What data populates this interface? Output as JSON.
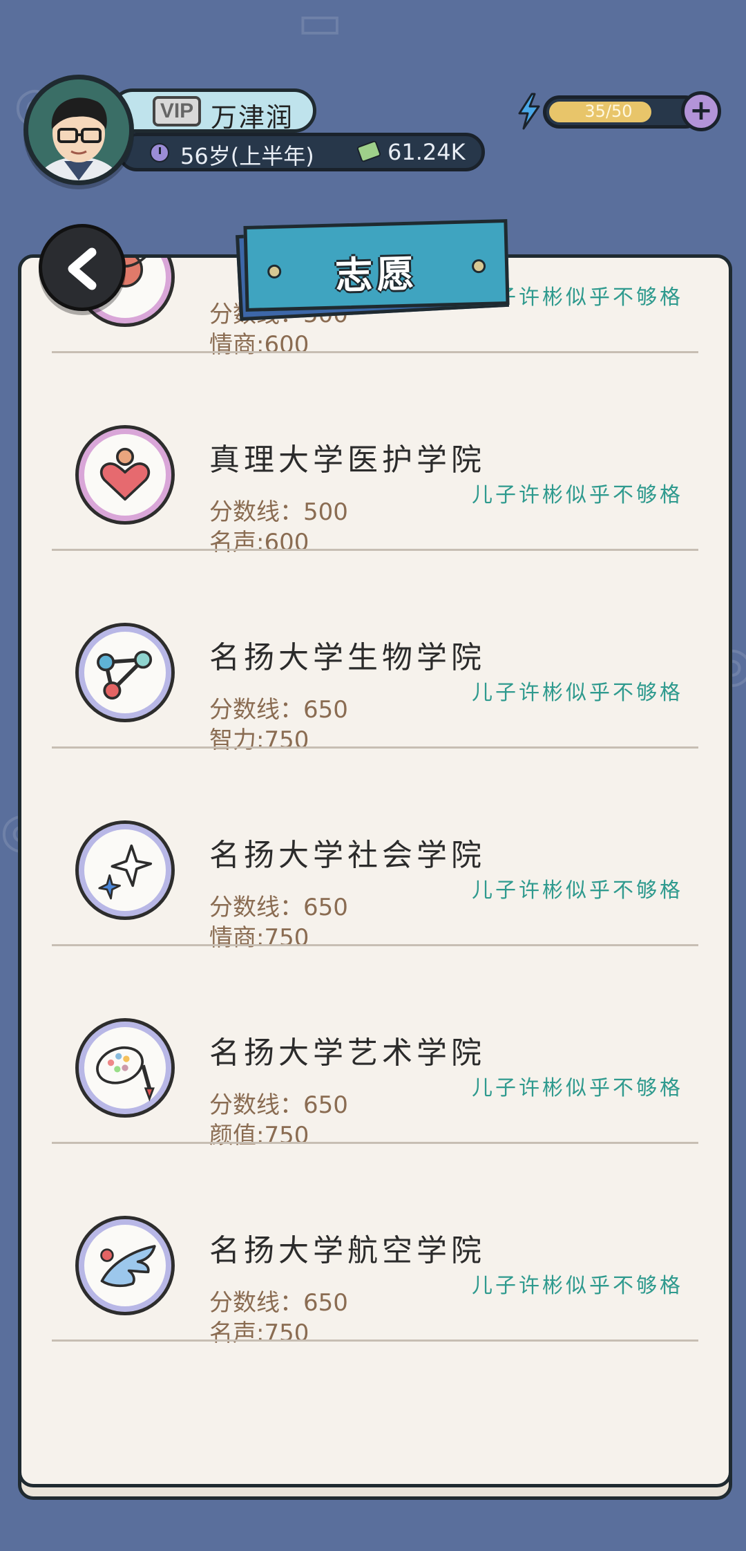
{
  "header": {
    "vip_label": "VIP",
    "player_name": "万津润",
    "age": "56岁(上半年)",
    "money": "61.24K",
    "energy": {
      "text": "35/50",
      "current": 35,
      "max": 50
    },
    "add_energy_label": "+"
  },
  "panel": {
    "title": "志愿",
    "back_label": "back"
  },
  "colleges": [
    {
      "title": "",
      "score": "分数线：500",
      "requirement": "情商:600",
      "status": "儿子许彬似乎不够格",
      "icon": "smile-icon"
    },
    {
      "title": "真理大学医护学院",
      "score": "分数线：500",
      "requirement": "名声:600",
      "status": "儿子许彬似乎不够格",
      "icon": "heart-person-icon"
    },
    {
      "title": "名扬大学生物学院",
      "score": "分数线：650",
      "requirement": "智力:750",
      "status": "儿子许彬似乎不够格",
      "icon": "molecule-icon"
    },
    {
      "title": "名扬大学社会学院",
      "score": "分数线：650",
      "requirement": "情商:750",
      "status": "儿子许彬似乎不够格",
      "icon": "sparkle-icon"
    },
    {
      "title": "名扬大学艺术学院",
      "score": "分数线：650",
      "requirement": "颜值:750",
      "status": "儿子许彬似乎不够格",
      "icon": "palette-icon"
    },
    {
      "title": "名扬大学航空学院",
      "score": "分数线：650",
      "requirement": "名声:750",
      "status": "儿子许彬似乎不够格",
      "icon": "wing-icon"
    }
  ],
  "colors": {
    "background": "#5a6f9c",
    "status_text": "#2f9a8e",
    "banner": "#3fa4c0"
  }
}
